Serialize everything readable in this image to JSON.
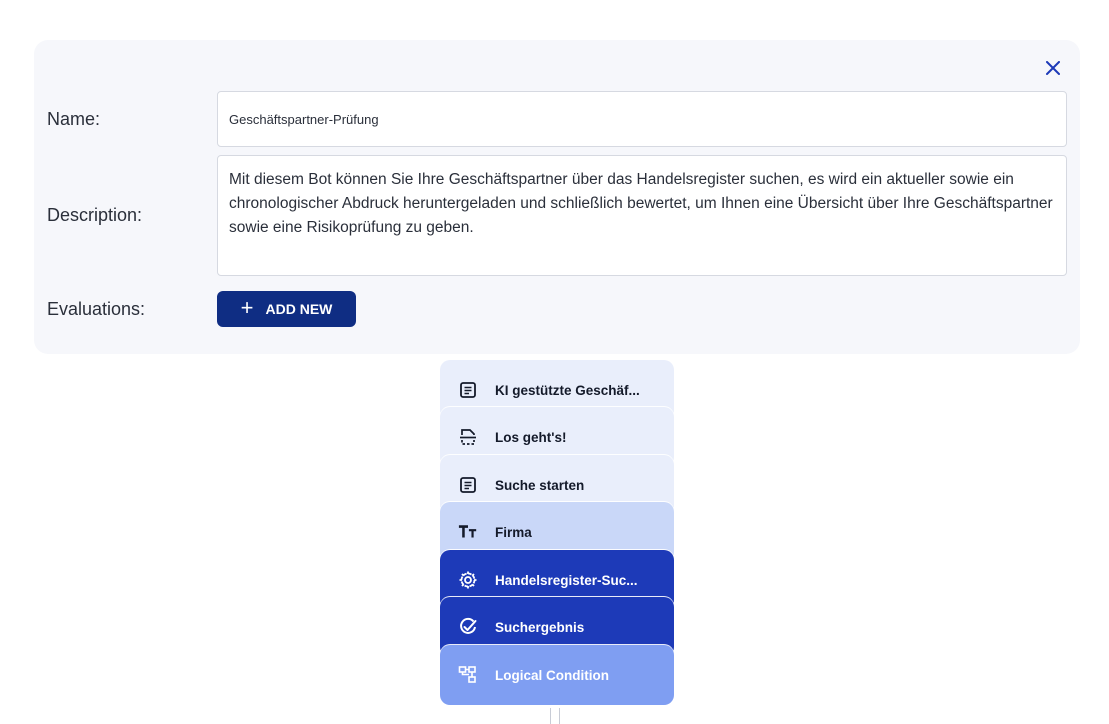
{
  "form": {
    "name_label": "Name:",
    "name_value": "Geschäftspartner-Prüfung",
    "description_label": "Description:",
    "description_value": "Mit diesem Bot können Sie Ihre Geschäftspartner über das Handelsregister suchen, es wird ein aktueller sowie ein chronologischer Abdruck heruntergeladen und schließlich bewertet, um Ihnen eine Übersicht über Ihre Geschäftspartner sowie eine Risikoprüfung zu geben.",
    "evaluations_label": "Evaluations:",
    "add_new_label": "ADD NEW",
    "close_icon": "close-icon"
  },
  "flow": {
    "steps": [
      {
        "label": "KI gestützte Geschäf...",
        "icon": "document-icon",
        "style": "light"
      },
      {
        "label": "Los geht's!",
        "icon": "start-icon",
        "style": "light"
      },
      {
        "label": "Suche starten",
        "icon": "document-icon",
        "style": "light"
      },
      {
        "label": "Firma",
        "icon": "text-icon",
        "style": "mid"
      },
      {
        "label": "Handelsregister-Suc...",
        "icon": "gear-icon",
        "style": "dark"
      },
      {
        "label": "Suchergebnis",
        "icon": "verified-icon",
        "style": "dark"
      },
      {
        "label": "Logical Condition",
        "icon": "condition-icon",
        "style": "sky"
      }
    ]
  },
  "colors": {
    "primary": "#0f2d83",
    "card_light": "#e9eefb",
    "card_mid": "#c9d7f8",
    "card_dark": "#1d3ab8",
    "card_sky": "#7f9ef2"
  }
}
